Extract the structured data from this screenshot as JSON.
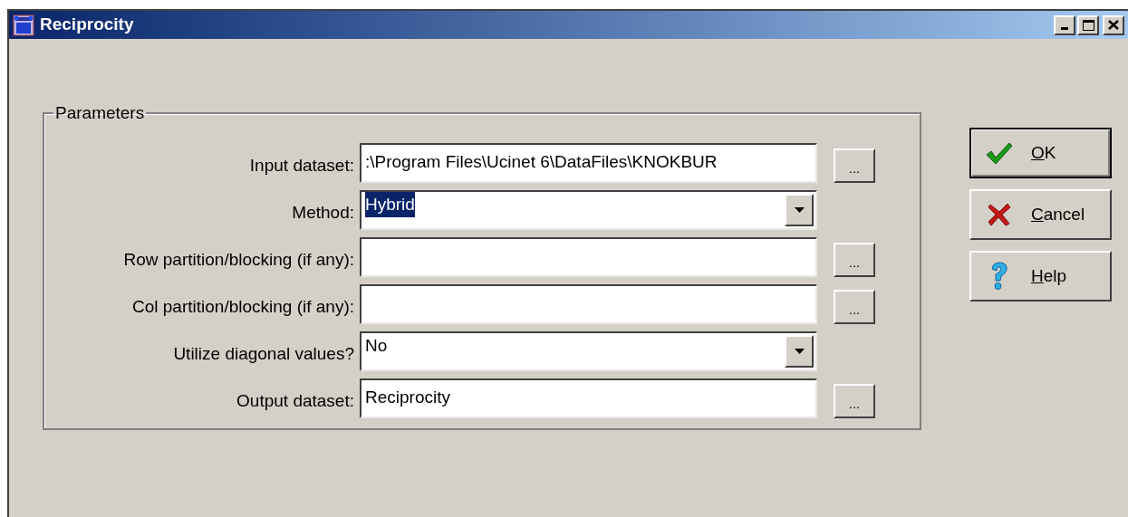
{
  "window": {
    "title": "Reciprocity"
  },
  "parameters": {
    "title": "Parameters",
    "rows": [
      {
        "label": "Input dataset:",
        "kind": "text",
        "value": ":\\Program Files\\Ucinet 6\\DataFiles\\KNOKBUR",
        "highlighted": false,
        "browse": "..."
      },
      {
        "label": "Method:",
        "kind": "dropdown",
        "value": "Hybrid",
        "highlighted": true
      },
      {
        "label": "Row partition/blocking (if any):",
        "kind": "text",
        "browse": "..."
      },
      {
        "label": "Col partition/blocking (if any):",
        "kind": "text",
        "browse": "..."
      },
      {
        "label": "Utilize diagonal values?",
        "kind": "dropdown",
        "value": "No",
        "highlighted": false
      },
      {
        "label": "Output dataset:",
        "kind": "text",
        "value": "Reciprocity",
        "highlighted": false,
        "browse": "..."
      }
    ]
  },
  "buttons": [
    {
      "label": "OK",
      "kind": "ok",
      "default": true
    },
    {
      "label": "Cancel",
      "kind": "cancel",
      "default": false
    },
    {
      "label": "Help",
      "kind": "help",
      "default": false
    }
  ]
}
